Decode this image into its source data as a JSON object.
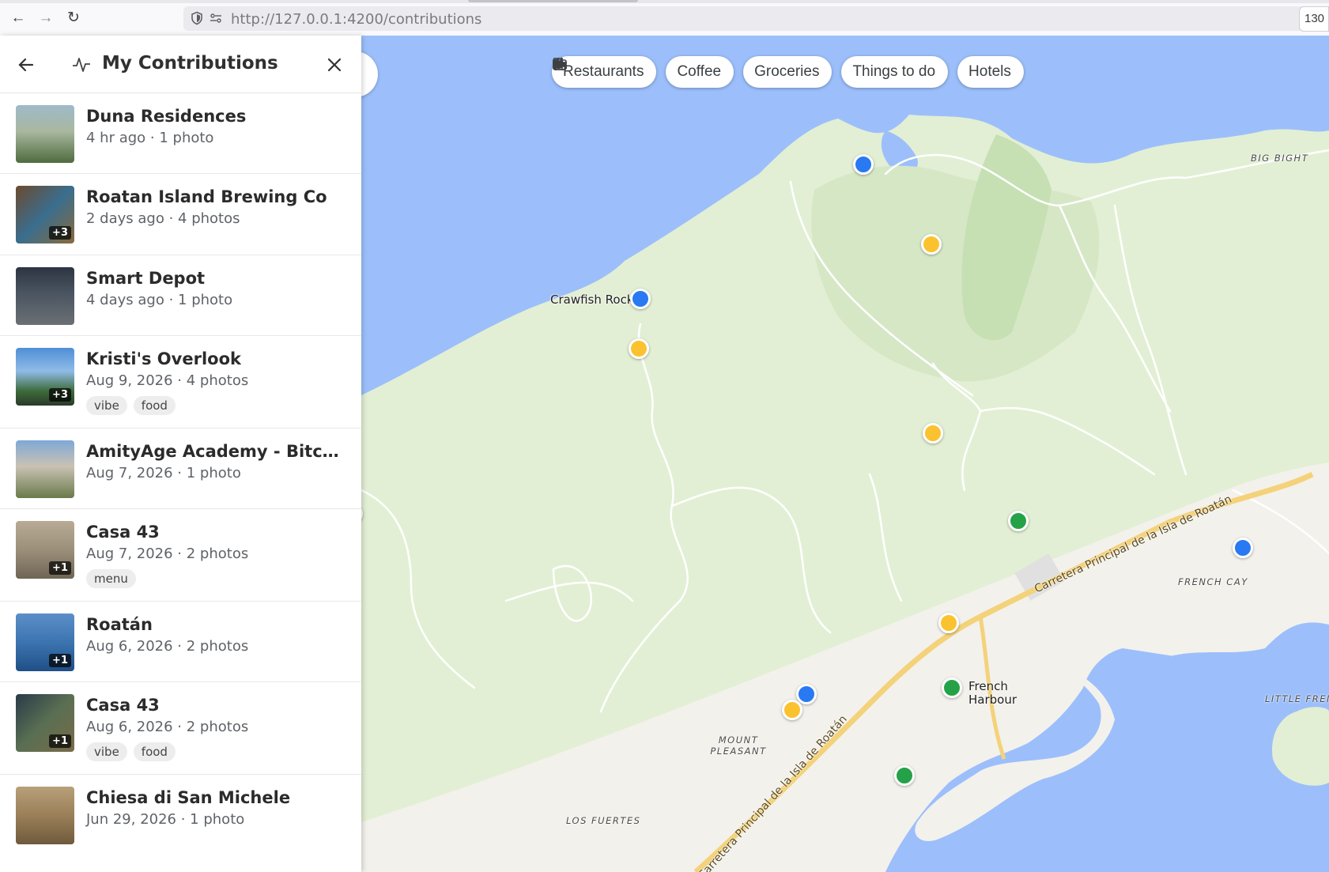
{
  "browser": {
    "url": "http://127.0.0.1:4200/contributions",
    "zoom": "130"
  },
  "sidebar": {
    "title": "My Contributions",
    "items": [
      {
        "name": "Duna Residences",
        "meta": "4 hr ago · 1 photo",
        "more": "",
        "tags": []
      },
      {
        "name": "Roatan Island Brewing Co",
        "meta": "2 days ago · 4 photos",
        "more": "+3",
        "tags": []
      },
      {
        "name": "Smart Depot",
        "meta": "4 days ago · 1 photo",
        "more": "",
        "tags": []
      },
      {
        "name": "Kristi's Overlook",
        "meta": "Aug 9, 2026 · 4 photos",
        "more": "+3",
        "tags": [
          "vibe",
          "food"
        ]
      },
      {
        "name": "AmityAge Academy - Bitcoin ...",
        "meta": "Aug 7, 2026 · 1 photo",
        "more": "",
        "tags": []
      },
      {
        "name": "Casa 43",
        "meta": "Aug 7, 2026 · 2 photos",
        "more": "+1",
        "tags": [
          "menu"
        ]
      },
      {
        "name": "Roatán",
        "meta": "Aug 6, 2026 · 2 photos",
        "more": "+1",
        "tags": []
      },
      {
        "name": "Casa 43",
        "meta": "Aug 6, 2026 · 2 photos",
        "more": "+1",
        "tags": [
          "vibe",
          "food"
        ]
      },
      {
        "name": "Chiesa di San Michele",
        "meta": "Jun 29, 2026 · 1 photo",
        "more": "",
        "tags": []
      }
    ]
  },
  "chips": [
    {
      "label": "Restaurants",
      "icon": "fork-knife-icon"
    },
    {
      "label": "Coffee",
      "icon": "coffee-cup-icon"
    },
    {
      "label": "Groceries",
      "icon": "basket-icon"
    },
    {
      "label": "Things to do",
      "icon": "camera-icon"
    },
    {
      "label": "Hotels",
      "icon": "bed-icon"
    }
  ],
  "map": {
    "labels": {
      "crawfish": "Crawfish Rock",
      "big_bight": "BIG BIGHT",
      "french_cay": "FRENCH CAY",
      "french_harbour": "French Harbour",
      "mount_pleasant": "MOUNT PLEASANT",
      "los_fuertes": "LOS FUERTES",
      "little_french": "LITTLE FRENCH",
      "road": "Carretera Principal de la Isla de Roatán"
    },
    "pin_colors": {
      "blue": "#2979f2",
      "yellow": "#fbc22f",
      "green": "#25a248"
    }
  }
}
